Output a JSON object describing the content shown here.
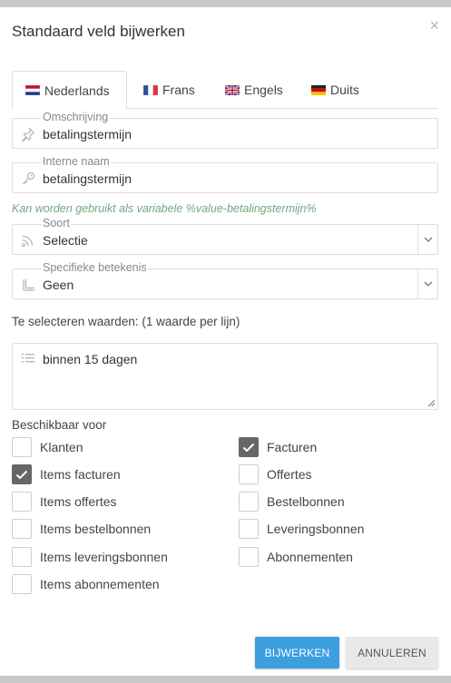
{
  "dialog": {
    "title": "Standaard veld bijwerken",
    "close_symbol": "×"
  },
  "tabs": [
    {
      "label": "Nederlands",
      "flag": "flag-nl-icon",
      "active": true
    },
    {
      "label": "Frans",
      "flag": "flag-fr-icon",
      "active": false
    },
    {
      "label": "Engels",
      "flag": "flag-gb-icon",
      "active": false
    },
    {
      "label": "Duits",
      "flag": "flag-de-icon",
      "active": false
    }
  ],
  "fields": {
    "description": {
      "label": "Omschrijving",
      "value": "betalingstermijn",
      "icon": "pin-icon"
    },
    "internal_name": {
      "label": "Interne naam",
      "value": "betalingstermijn",
      "icon": "key-icon"
    },
    "hint": "Kan worden gebruikt als variabele %value-betalingstermijn%",
    "type": {
      "label": "Soort",
      "value": "Selectie",
      "icon": "rss-icon"
    },
    "meaning": {
      "label": "Specifieke betekenis",
      "value": "Geen",
      "icon": "ruler-icon"
    }
  },
  "values_section": {
    "label": "Te selecteren waarden: (1 waarde per lijn)",
    "value": "binnen 15 dagen",
    "icon": "list-icon"
  },
  "available_for": {
    "label": "Beschikbaar voor",
    "left": [
      {
        "label": "Klanten",
        "checked": false
      },
      {
        "label": "Items facturen",
        "checked": true
      },
      {
        "label": "Items offertes",
        "checked": false
      },
      {
        "label": "Items bestelbonnen",
        "checked": false
      },
      {
        "label": "Items leveringsbonnen",
        "checked": false
      },
      {
        "label": "Items abonnementen",
        "checked": false
      }
    ],
    "right": [
      {
        "label": "Facturen",
        "checked": true
      },
      {
        "label": "Offertes",
        "checked": false
      },
      {
        "label": "Bestelbonnen",
        "checked": false
      },
      {
        "label": "Leveringsbonnen",
        "checked": false
      },
      {
        "label": "Abonnementen",
        "checked": false
      }
    ]
  },
  "buttons": {
    "update": "BIJWERKEN",
    "cancel": "ANNULEREN"
  },
  "colors": {
    "primary": "#3b9fde",
    "hint": "#74a77e",
    "checked": "#666666"
  }
}
